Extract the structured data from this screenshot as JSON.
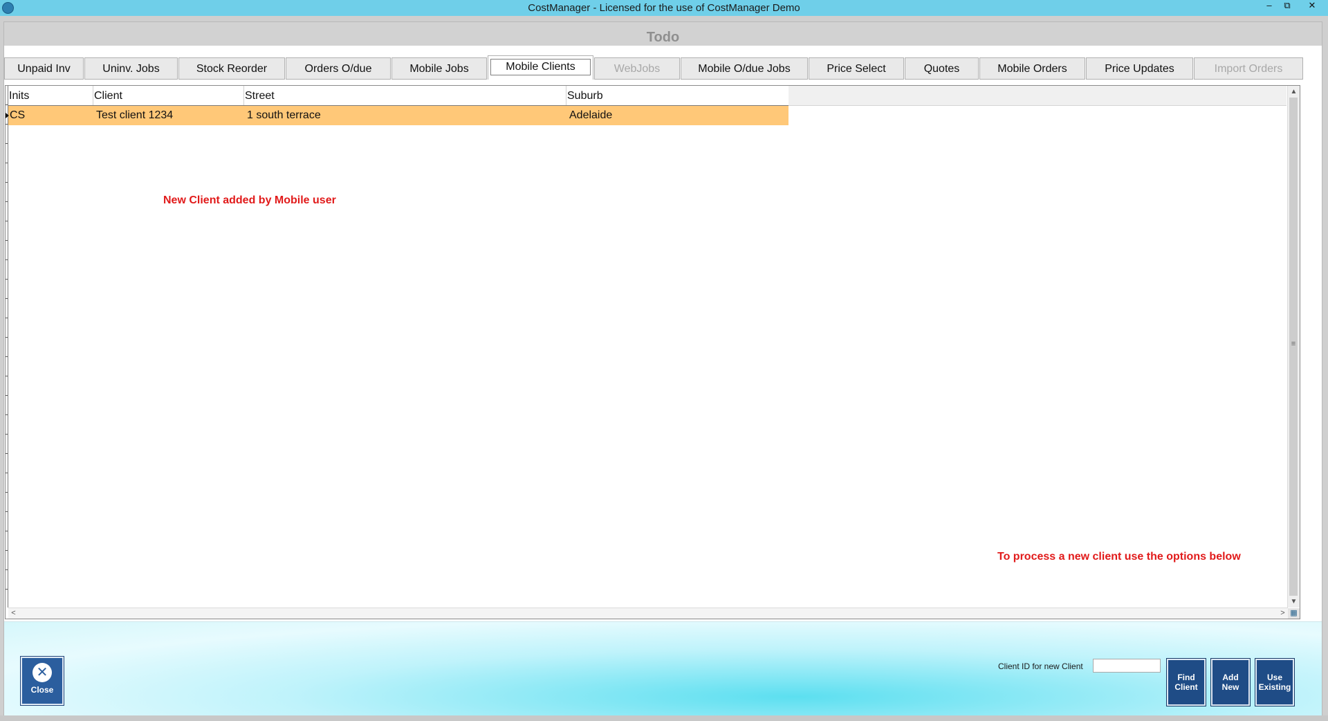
{
  "window": {
    "title": "CostManager - Licensed for the use of CostManager Demo",
    "minimize": "–",
    "restore": "⧉",
    "close": "✕"
  },
  "page": {
    "title": "Todo"
  },
  "tabs": [
    {
      "label": "Unpaid Inv",
      "state": "normal"
    },
    {
      "label": "Uninv. Jobs",
      "state": "normal"
    },
    {
      "label": "Stock Reorder",
      "state": "normal"
    },
    {
      "label": "Orders O/due",
      "state": "normal"
    },
    {
      "label": "Mobile Jobs",
      "state": "normal"
    },
    {
      "label": "Mobile Clients",
      "state": "active"
    },
    {
      "label": "WebJobs",
      "state": "disabled"
    },
    {
      "label": "Mobile O/due Jobs",
      "state": "normal"
    },
    {
      "label": "Price Select",
      "state": "normal"
    },
    {
      "label": "Quotes",
      "state": "normal"
    },
    {
      "label": "Mobile Orders",
      "state": "normal"
    },
    {
      "label": "Price Updates",
      "state": "normal"
    },
    {
      "label": "Import Orders",
      "state": "disabled"
    }
  ],
  "grid": {
    "columns": [
      "Inits",
      "Client",
      "Street",
      "Suburb"
    ],
    "rows": [
      {
        "inits": "CS",
        "client": "Test client 1234",
        "street": "1 south terrace",
        "suburb": "Adelaide"
      }
    ],
    "selected_row_color": "#ffc878"
  },
  "annotations": {
    "new_client": "New Client added by Mobile user",
    "process_hint": "To process a new client use the options below",
    "color": "#e11a1a"
  },
  "bottom": {
    "close_label": "Close",
    "client_id_label": "Client ID for new Client",
    "client_id_value": "",
    "find_client_label": "Find Client",
    "add_new_label": "Add New",
    "use_existing_label": "Use Existing"
  },
  "colors": {
    "titlebar": "#6fcfe9",
    "button_blue": "#1f4c86",
    "panel_cyan": "#5cdff0"
  }
}
